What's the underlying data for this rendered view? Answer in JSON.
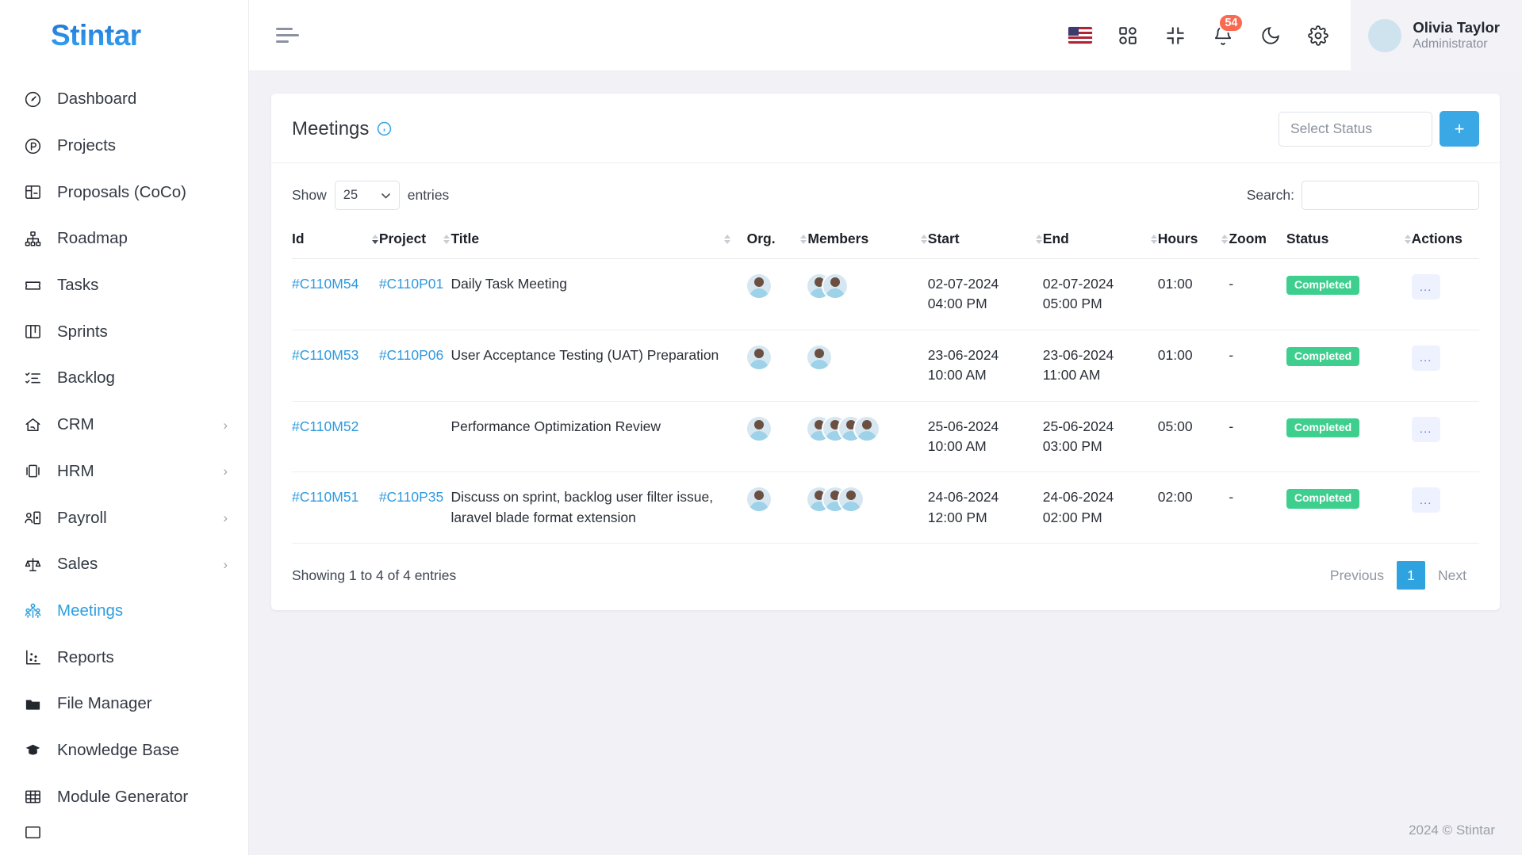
{
  "brand": {
    "name": "Stintar"
  },
  "sidebar": {
    "items": [
      {
        "label": "Dashboard",
        "icon": "gauge-icon",
        "hasChevron": false,
        "active": false
      },
      {
        "label": "Projects",
        "icon": "circle-p-icon",
        "hasChevron": false,
        "active": false
      },
      {
        "label": "Proposals (CoCo)",
        "icon": "layout-panels-icon",
        "hasChevron": false,
        "active": false
      },
      {
        "label": "Roadmap",
        "icon": "hierarchy-icon",
        "hasChevron": false,
        "active": false
      },
      {
        "label": "Tasks",
        "icon": "ticket-icon",
        "hasChevron": false,
        "active": false
      },
      {
        "label": "Sprints",
        "icon": "kanban-board-icon",
        "hasChevron": false,
        "active": false
      },
      {
        "label": "Backlog",
        "icon": "checklist-icon",
        "hasChevron": false,
        "active": false
      },
      {
        "label": "CRM",
        "icon": "handshake-home-icon",
        "hasChevron": true,
        "active": false
      },
      {
        "label": "HRM",
        "icon": "id-card-icon",
        "hasChevron": true,
        "active": false
      },
      {
        "label": "Payroll",
        "icon": "person-badge-icon",
        "hasChevron": true,
        "active": false
      },
      {
        "label": "Sales",
        "icon": "scales-icon",
        "hasChevron": true,
        "active": false
      },
      {
        "label": "Meetings",
        "icon": "people-group-icon",
        "hasChevron": false,
        "active": true
      },
      {
        "label": "Reports",
        "icon": "scatter-chart-icon",
        "hasChevron": false,
        "active": false
      },
      {
        "label": "File Manager",
        "icon": "folder-icon",
        "hasChevron": false,
        "active": false
      },
      {
        "label": "Knowledge Base",
        "icon": "graduation-cap-icon",
        "hasChevron": false,
        "active": false
      },
      {
        "label": "Module Generator",
        "icon": "grid-table-icon",
        "hasChevron": false,
        "active": false
      }
    ]
  },
  "topbar": {
    "menu_toggle": "hamburger-icon",
    "language_flag": "us-flag-icon",
    "apps": "apps-grid-icon",
    "fullscreen": "compress-icon",
    "notifications": {
      "icon": "bell-icon",
      "count": "54"
    },
    "theme": "moon-icon",
    "settings": "gear-icon",
    "user": {
      "name": "Olivia Taylor",
      "role": "Administrator"
    }
  },
  "card": {
    "title": "Meetings",
    "info_icon": "info-circle-icon",
    "status_filter_placeholder": "Select Status",
    "add_button_label": "+"
  },
  "table_controls": {
    "show_label": "Show",
    "entries_label": "entries",
    "page_length": "25",
    "search_label": "Search:",
    "search_value": "",
    "search_placeholder": ""
  },
  "table": {
    "columns": [
      {
        "label": "Id",
        "sortable": true,
        "sorted": "desc"
      },
      {
        "label": "Project",
        "sortable": true,
        "sorted": "none"
      },
      {
        "label": "Title",
        "sortable": true,
        "sorted": "none"
      },
      {
        "label": "Org.",
        "sortable": true,
        "sorted": "none"
      },
      {
        "label": "Members",
        "sortable": true,
        "sorted": "none"
      },
      {
        "label": "Start",
        "sortable": true,
        "sorted": "none"
      },
      {
        "label": "End",
        "sortable": true,
        "sorted": "none"
      },
      {
        "label": "Hours",
        "sortable": true,
        "sorted": "none"
      },
      {
        "label": "Zoom",
        "sortable": false,
        "sorted": "none"
      },
      {
        "label": "Status",
        "sortable": true,
        "sorted": "none"
      },
      {
        "label": "Actions",
        "sortable": false,
        "sorted": "none"
      }
    ],
    "rows": [
      {
        "id": "#C110M54",
        "project": "#C110P01",
        "title": "Daily Task Meeting",
        "org_avatars": 1,
        "member_avatars": 2,
        "start_date": "02-07-2024",
        "start_time": "04:00 PM",
        "end_date": "02-07-2024",
        "end_time": "05:00 PM",
        "hours": "01:00",
        "zoom": "-",
        "status": "Completed",
        "actions": "..."
      },
      {
        "id": "#C110M53",
        "project": "#C110P06",
        "title": "User Acceptance Testing (UAT) Preparation",
        "org_avatars": 1,
        "member_avatars": 1,
        "start_date": "23-06-2024",
        "start_time": "10:00 AM",
        "end_date": "23-06-2024",
        "end_time": "11:00 AM",
        "hours": "01:00",
        "zoom": "-",
        "status": "Completed",
        "actions": "..."
      },
      {
        "id": "#C110M52",
        "project": "",
        "title": "Performance Optimization Review",
        "org_avatars": 1,
        "member_avatars": 4,
        "start_date": "25-06-2024",
        "start_time": "10:00 AM",
        "end_date": "25-06-2024",
        "end_time": "03:00 PM",
        "hours": "05:00",
        "zoom": "-",
        "status": "Completed",
        "actions": "..."
      },
      {
        "id": "#C110M51",
        "project": "#C110P35",
        "title": "Discuss on sprint, backlog user filter issue, laravel blade format extension",
        "org_avatars": 1,
        "member_avatars": 3,
        "start_date": "24-06-2024",
        "start_time": "12:00 PM",
        "end_date": "24-06-2024",
        "end_time": "02:00 PM",
        "hours": "02:00",
        "zoom": "-",
        "status": "Completed",
        "actions": "..."
      }
    ]
  },
  "table_footer": {
    "info": "Showing 1 to 4 of 4 entries",
    "previous": "Previous",
    "page": "1",
    "next": "Next"
  },
  "footer": {
    "copyright": "2024 © Stintar"
  },
  "colors": {
    "accent": "#2ea3e0",
    "link": "#2e9ae0",
    "success": "#3ecf8e",
    "badge": "#fa6a52",
    "sidebar_bg": "#ffffff",
    "page_bg": "#f1f1f6"
  }
}
